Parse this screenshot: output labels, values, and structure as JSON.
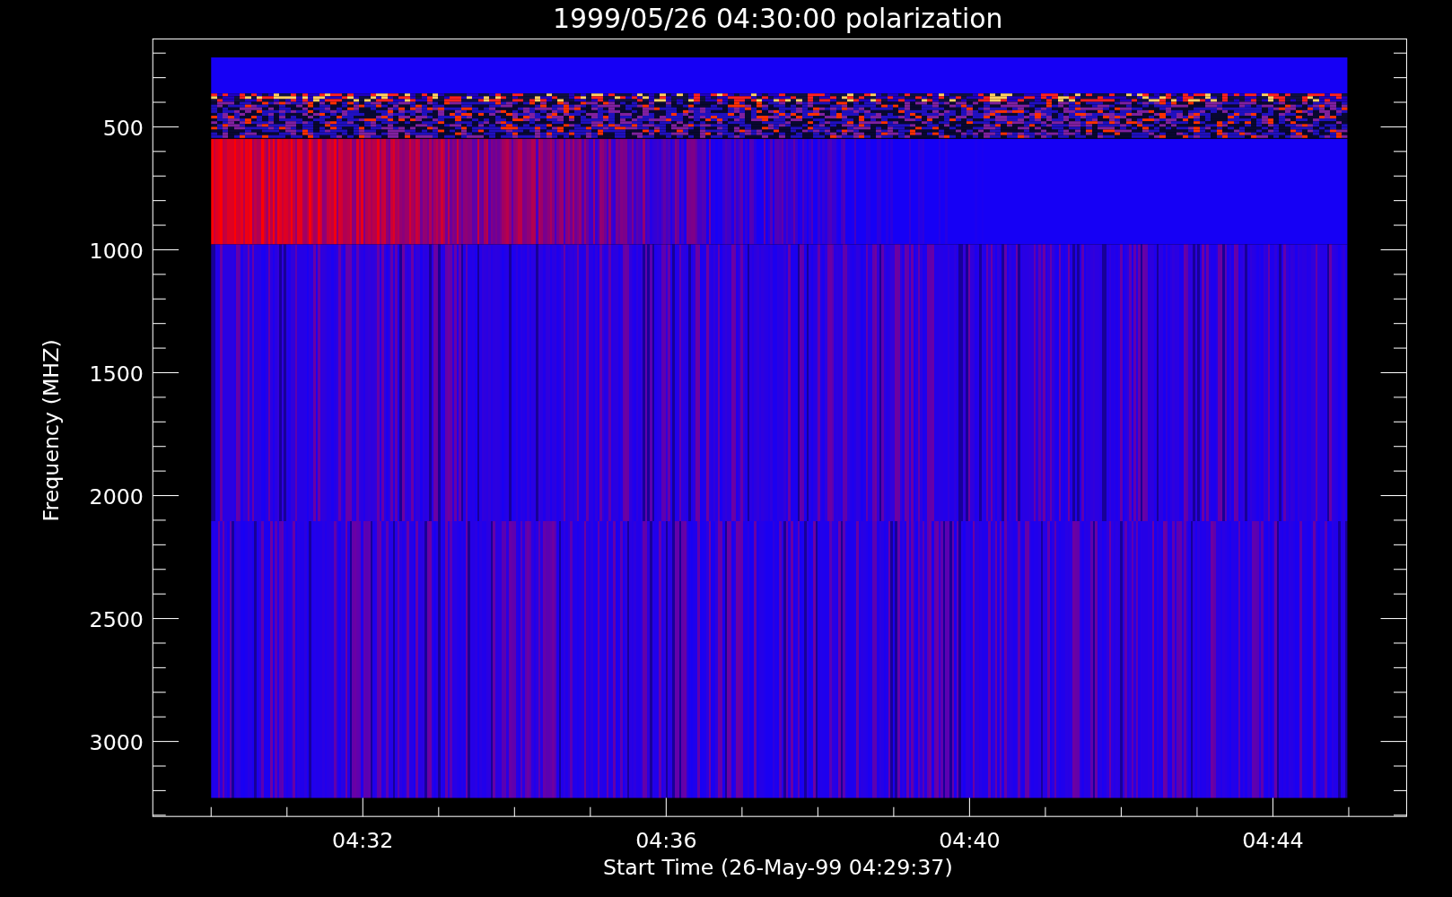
{
  "title": "1999/05/26 04:30:00 polarization",
  "y_axis": {
    "label": "Frequency (MHZ)",
    "ticks": [
      "500",
      "1000",
      "1500",
      "2000",
      "2500",
      "3000"
    ]
  },
  "x_axis": {
    "label": "Start Time (26-May-99 04:29:37)",
    "ticks": [
      "04:32",
      "04:36",
      "04:40",
      "04:44"
    ]
  }
}
